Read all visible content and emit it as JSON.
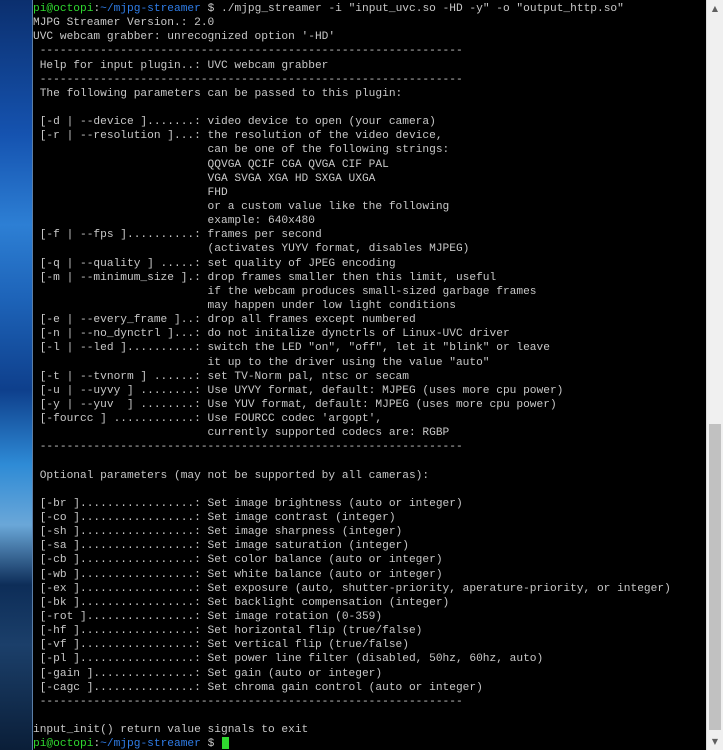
{
  "prompt": {
    "user_host": "pi@octopi",
    "separator": ":",
    "path": "~/mjpg-streamer",
    "symbol": " $ ",
    "command": "./mjpg_streamer -i \"input_uvc.so -HD -y\" -o \"output_http.so\""
  },
  "output_lines": [
    "MJPG Streamer Version.: 2.0",
    "UVC webcam grabber: unrecognized option '-HD'",
    " ---------------------------------------------------------------",
    " Help for input plugin..: UVC webcam grabber",
    " ---------------------------------------------------------------",
    " The following parameters can be passed to this plugin:",
    "",
    " [-d | --device ].......: video device to open (your camera)",
    " [-r | --resolution ]...: the resolution of the video device,",
    "                          can be one of the following strings:",
    "                          QQVGA QCIF CGA QVGA CIF PAL",
    "                          VGA SVGA XGA HD SXGA UXGA",
    "                          FHD",
    "                          or a custom value like the following",
    "                          example: 640x480",
    " [-f | --fps ]..........: frames per second",
    "                          (activates YUYV format, disables MJPEG)",
    " [-q | --quality ] .....: set quality of JPEG encoding",
    " [-m | --minimum_size ].: drop frames smaller then this limit, useful",
    "                          if the webcam produces small-sized garbage frames",
    "                          may happen under low light conditions",
    " [-e | --every_frame ]..: drop all frames except numbered",
    " [-n | --no_dynctrl ]...: do not initalize dynctrls of Linux-UVC driver",
    " [-l | --led ]..........: switch the LED \"on\", \"off\", let it \"blink\" or leave",
    "                          it up to the driver using the value \"auto\"",
    " [-t | --tvnorm ] ......: set TV-Norm pal, ntsc or secam",
    " [-u | --uyvy ] ........: Use UYVY format, default: MJPEG (uses more cpu power)",
    " [-y | --yuv  ] ........: Use YUV format, default: MJPEG (uses more cpu power)",
    " [-fourcc ] ............: Use FOURCC codec 'argopt',",
    "                          currently supported codecs are: RGBP",
    " ---------------------------------------------------------------",
    "",
    " Optional parameters (may not be supported by all cameras):",
    "",
    " [-br ].................: Set image brightness (auto or integer)",
    " [-co ].................: Set image contrast (integer)",
    " [-sh ].................: Set image sharpness (integer)",
    " [-sa ].................: Set image saturation (integer)",
    " [-cb ].................: Set color balance (auto or integer)",
    " [-wb ].................: Set white balance (auto or integer)",
    " [-ex ].................: Set exposure (auto, shutter-priority, aperature-priority, or integer)",
    " [-bk ].................: Set backlight compensation (integer)",
    " [-rot ]................: Set image rotation (0-359)",
    " [-hf ].................: Set horizontal flip (true/false)",
    " [-vf ].................: Set vertical flip (true/false)",
    " [-pl ].................: Set power line filter (disabled, 50hz, 60hz, auto)",
    " [-gain ]...............: Set gain (auto or integer)",
    " [-cagc ]...............: Set chroma gain control (auto or integer)",
    " ---------------------------------------------------------------",
    "",
    "input_init() return value signals to exit"
  ],
  "colors": {
    "background": "#000000",
    "text": "#c8c8c8",
    "user_host": "#2fd82f",
    "path": "#2f7de8",
    "cursor": "#2fd82f"
  },
  "scrollbar": {
    "up_icon": "triangle-up-icon",
    "down_icon": "triangle-down-icon"
  }
}
